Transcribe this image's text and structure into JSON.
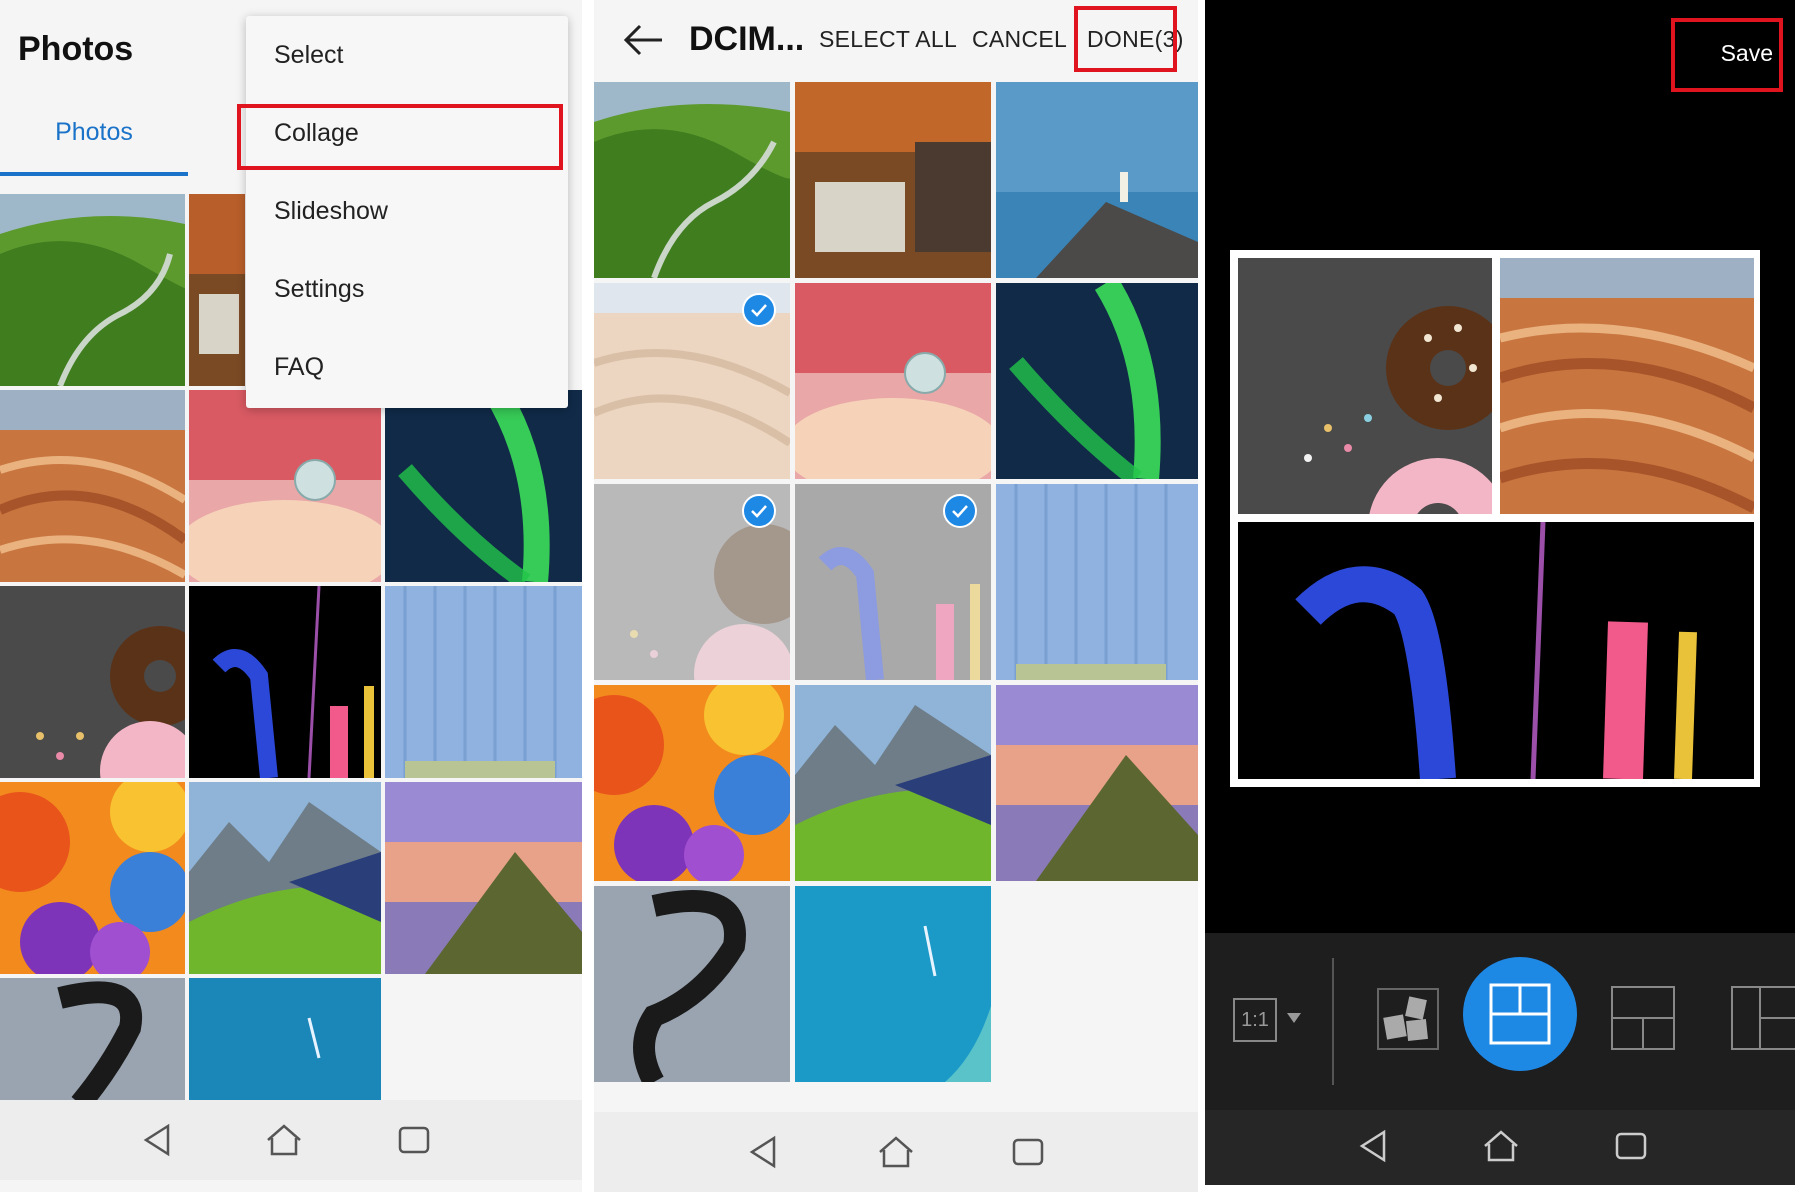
{
  "panel1": {
    "app_title": "Photos",
    "tab_photos": "Photos",
    "menu": [
      "Select",
      "Collage",
      "Slideshow",
      "Settings",
      "FAQ"
    ],
    "highlighted_menu_item": "Collage",
    "nav_icons": [
      "back-icon",
      "home-icon",
      "recents-icon"
    ]
  },
  "panel2": {
    "title": "DCIM...",
    "select_all": "SELECT ALL",
    "cancel": "CANCEL",
    "done": "DONE(3)",
    "selected_count": 3,
    "accent": "#1e88e5"
  },
  "panel3": {
    "save_label": "Save",
    "ratio_label": "1:1",
    "layout_icons": [
      "shuffle-layout-icon",
      "grid-2-1-layout-icon",
      "grid-2x2-layout-icon",
      "grid-columns-layout-icon"
    ],
    "active_accent": "#1e88e5"
  },
  "highlight_color": "#e0141e"
}
